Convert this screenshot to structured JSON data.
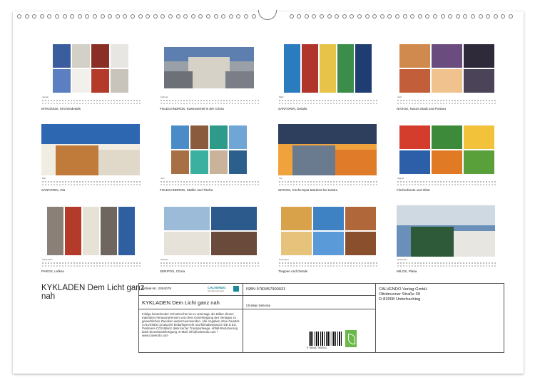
{
  "months": [
    {
      "name": "Januar",
      "caption": "MYKONOS, Kirchendetails"
    },
    {
      "name": "Februar",
      "caption": "FOLEGANDROS, Kastroviertel in der Chora"
    },
    {
      "name": "März",
      "caption": "SANTORIN, Details"
    },
    {
      "name": "April",
      "caption": "NAXOS, Naxos Stadt und Portara"
    },
    {
      "name": "Mai",
      "caption": "SANTORIN, Oia"
    },
    {
      "name": "Juni",
      "caption": "FOLEGANDROS, Stühle und Tische"
    },
    {
      "name": "Juli",
      "caption": "SIFNOS, Kirche Epta Martires bei Kastro"
    },
    {
      "name": "August",
      "caption": "Fischerboote und Obst"
    },
    {
      "name": "September",
      "caption": "PAROS, Lefkes"
    },
    {
      "name": "Oktober",
      "caption": "SERIFOS, Chora"
    },
    {
      "name": "November",
      "caption": "Treppen und Details"
    },
    {
      "name": "Dezember",
      "caption": "MILOS, Plaka"
    }
  ],
  "title": "KYKLADEN Dem Licht ganz nah",
  "info": {
    "article": "Artikel-Nr. 2004078",
    "subtitle": "KYKLADEN Dem Licht ganz nah",
    "legal": "Infolge bestehender Schutzrechte ist es untersagt, die Bilder dieses Kalenders herauszutrennen und ohne Genehmigung des Verlages zu gewerblichen Zwecken weiterzuverwenden. Alle Angaben ohne Gewähr. CALVENDO produziert bedarfsgerecht und klimabewusst in DE & EU. Positivere CO2-Bilanz dank kurzer Transportwege. Abfall-Reduzierung dank Einzelstückfertigung. E-Mail: info@calvendo.com • www.calvendo.com",
    "isbn": "ISBN 9783457900031",
    "author": "Christian Dehncke",
    "publisher": [
      "CALVENDO Verlag GmbH",
      "Ottobrunner Straße 39",
      "D-82008 Unterhaching"
    ],
    "barcode_number": "9 783457 900031",
    "logo_text": "CALVENDO",
    "logo_sub": "Das Kalender-Label"
  }
}
